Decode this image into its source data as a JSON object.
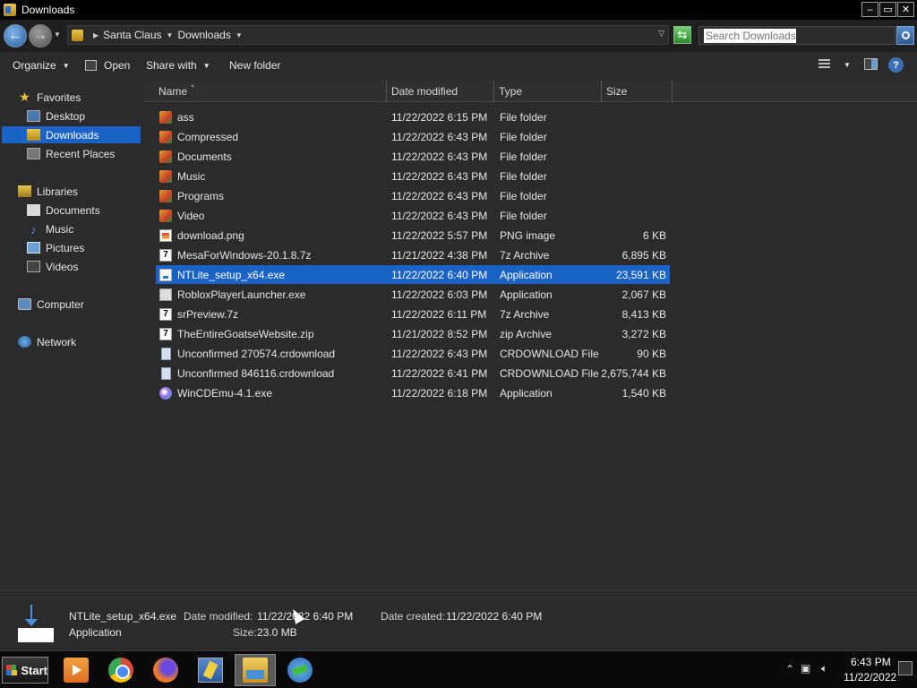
{
  "window": {
    "title": "Downloads",
    "minimize": "–",
    "maximize": "▭",
    "close": "✕"
  },
  "address": {
    "crumbs": [
      "Santa Claus",
      "Downloads"
    ],
    "search_placeholder": "Search Downloads"
  },
  "toolbar": {
    "organize": "Organize",
    "open": "Open",
    "share_with": "Share with",
    "new_folder": "New folder",
    "help": "?"
  },
  "nav": {
    "favorites": "Favorites",
    "desktop": "Desktop",
    "downloads": "Downloads",
    "recent_places": "Recent Places",
    "libraries": "Libraries",
    "documents": "Documents",
    "music": "Music",
    "pictures": "Pictures",
    "videos": "Videos",
    "computer": "Computer",
    "network": "Network"
  },
  "columns": {
    "name": "Name",
    "date_modified": "Date modified",
    "type": "Type",
    "size": "Size"
  },
  "files": [
    {
      "name": "ass",
      "date": "11/22/2022 6:15 PM",
      "type": "File folder",
      "size": "",
      "icon": "folder-icon"
    },
    {
      "name": "Compressed",
      "date": "11/22/2022 6:43 PM",
      "type": "File folder",
      "size": "",
      "icon": "folder-icon"
    },
    {
      "name": "Documents",
      "date": "11/22/2022 6:43 PM",
      "type": "File folder",
      "size": "",
      "icon": "folder-icon"
    },
    {
      "name": "Music",
      "date": "11/22/2022 6:43 PM",
      "type": "File folder",
      "size": "",
      "icon": "folder-icon"
    },
    {
      "name": "Programs",
      "date": "11/22/2022 6:43 PM",
      "type": "File folder",
      "size": "",
      "icon": "folder-icon"
    },
    {
      "name": "Video",
      "date": "11/22/2022 6:43 PM",
      "type": "File folder",
      "size": "",
      "icon": "folder-icon"
    },
    {
      "name": "download.png",
      "date": "11/22/2022 5:57 PM",
      "type": "PNG image",
      "size": "6 KB",
      "icon": "png-image-icon"
    },
    {
      "name": "MesaForWindows-20.1.8.7z",
      "date": "11/21/2022 4:38 PM",
      "type": "7z Archive",
      "size": "6,895 KB",
      "icon": "7z-archive-icon"
    },
    {
      "name": "NTLite_setup_x64.exe",
      "date": "11/22/2022 6:40 PM",
      "type": "Application",
      "size": "23,591 KB",
      "icon": "ntlite-app-icon"
    },
    {
      "name": "RobloxPlayerLauncher.exe",
      "date": "11/22/2022 6:03 PM",
      "type": "Application",
      "size": "2,067 KB",
      "icon": "roblox-app-icon"
    },
    {
      "name": "srPreview.7z",
      "date": "11/22/2022 6:11 PM",
      "type": "7z Archive",
      "size": "8,413 KB",
      "icon": "7z-archive-icon"
    },
    {
      "name": "TheEntireGoatseWebsite.zip",
      "date": "11/21/2022 8:52 PM",
      "type": "zip Archive",
      "size": "3,272 KB",
      "icon": "zip-archive-icon"
    },
    {
      "name": "Unconfirmed 270574.crdownload",
      "date": "11/22/2022 6:43 PM",
      "type": "CRDOWNLOAD File",
      "size": "90 KB",
      "icon": "crdownload-file-icon"
    },
    {
      "name": "Unconfirmed 846116.crdownload",
      "date": "11/22/2022 6:41 PM",
      "type": "CRDOWNLOAD File",
      "size": "2,675,744 KB",
      "icon": "crdownload-file-icon"
    },
    {
      "name": "WinCDEmu-4.1.exe",
      "date": "11/22/2022 6:18 PM",
      "type": "Application",
      "size": "1,540 KB",
      "icon": "wincdemu-app-icon"
    }
  ],
  "details": {
    "filename": "NTLite_setup_x64.exe",
    "filetype": "Application",
    "date_modified_label": "Date modified:",
    "date_modified": "11/22/2022 6:40 PM",
    "date_created_label": "Date created:",
    "date_created": "11/22/2022 6:40 PM",
    "size_label": "Size:",
    "size": "23.0 MB"
  },
  "taskbar": {
    "start": "Start",
    "apps": [
      "media-player-icon",
      "chrome-icon",
      "firefox-icon",
      "notes-icon",
      "file-explorer-icon",
      "download-manager-icon"
    ],
    "active_app": "file-explorer-icon",
    "clock_time": "6:43 PM",
    "clock_date": "11/22/2022"
  },
  "colors": {
    "selection": "#1a63c6",
    "background": "#2b2b2b",
    "titlebar": "#000000"
  }
}
